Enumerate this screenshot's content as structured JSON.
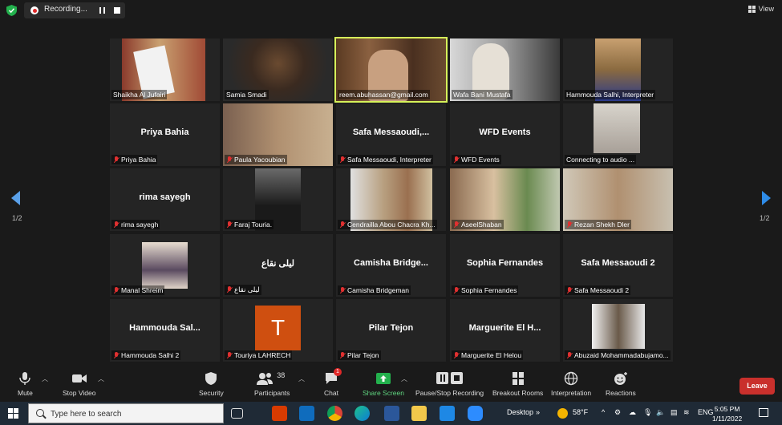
{
  "top_bar": {
    "recording_label": "Recording...",
    "view_label": "View"
  },
  "participants": [
    {
      "label": "Shaikha Al Jufairi",
      "center_name": "",
      "muted": false,
      "video": true
    },
    {
      "label": "Samia Smadi",
      "center_name": "",
      "muted": false,
      "video": true
    },
    {
      "label": "reem.abuhassan@gmail.com",
      "center_name": "",
      "muted": false,
      "video": true,
      "active_speaker": true
    },
    {
      "label": "Wafa Bani Mustafa",
      "center_name": "",
      "muted": false,
      "video": true
    },
    {
      "label": "Hammouda Salhi, Interpreter",
      "center_name": "",
      "muted": false,
      "video": true
    },
    {
      "label": "Priya Bahia",
      "center_name": "Priya Bahia",
      "muted": true,
      "video": false
    },
    {
      "label": "Paula Yacoubian",
      "center_name": "",
      "muted": true,
      "video": true
    },
    {
      "label": "Safa Messaoudi, Interpreter",
      "center_name": "Safa  Messaoudi,...",
      "muted": true,
      "video": false
    },
    {
      "label": "WFD Events",
      "center_name": "WFD Events",
      "muted": true,
      "video": false
    },
    {
      "label": "Connecting to audio ...",
      "center_name": "",
      "muted": false,
      "video": true
    },
    {
      "label": "rima sayegh",
      "center_name": "rima sayegh",
      "muted": true,
      "video": false
    },
    {
      "label": "Faraj Touria.",
      "center_name": "",
      "muted": true,
      "video": true
    },
    {
      "label": "Cendrailla Abou Chacra Kh...",
      "center_name": "",
      "muted": true,
      "video": true
    },
    {
      "label": "AseelShaban",
      "center_name": "",
      "muted": true,
      "video": true
    },
    {
      "label": "Rezan Shekh Dler",
      "center_name": "",
      "muted": true,
      "video": true
    },
    {
      "label": "Manal Shreim",
      "center_name": "",
      "muted": true,
      "video": true
    },
    {
      "label": "ليلى نقاع",
      "center_name": "ليلى نقاع",
      "muted": true,
      "video": false
    },
    {
      "label": "Camisha Bridgeman",
      "center_name": "Camisha  Bridge...",
      "muted": true,
      "video": false
    },
    {
      "label": "Sophia Fernandes",
      "center_name": "Sophia Fernandes",
      "muted": true,
      "video": false
    },
    {
      "label": "Safa Messaoudi 2",
      "center_name": "Safa Messaoudi 2",
      "muted": true,
      "video": false
    },
    {
      "label": "Hammouda Salhi 2",
      "center_name": "Hammouda  Sal...",
      "muted": true,
      "video": false
    },
    {
      "label": "Touriya LAHRECH",
      "center_name": "",
      "muted": true,
      "video": false,
      "avatar_letter": "T"
    },
    {
      "label": "Pilar Tejon",
      "center_name": "Pilar Tejon",
      "muted": true,
      "video": false
    },
    {
      "label": "Marguerite El Helou",
      "center_name": "Marguerite  El H...",
      "muted": true,
      "video": false
    },
    {
      "label": "Abuzaid Mohammadabujamo...",
      "center_name": "",
      "muted": true,
      "video": true
    }
  ],
  "pagination": {
    "left": "1/2",
    "right": "1/2"
  },
  "toolbar": {
    "mute": "Mute",
    "stop_video": "Stop Video",
    "security": "Security",
    "participants": "Participants",
    "participants_count": "38",
    "chat": "Chat",
    "chat_badge": "1",
    "share_screen": "Share Screen",
    "recording": "Pause/Stop Recording",
    "breakout": "Breakout Rooms",
    "interpretation": "Interpretation",
    "reactions": "Reactions",
    "leave": "Leave"
  },
  "taskbar": {
    "search_placeholder": "Type here to search",
    "desktop": "Desktop",
    "weather": "58°F",
    "lang": "ENG",
    "time": "5:05 PM",
    "date": "1/11/2022"
  },
  "colors": {
    "active_border": "#d6f25a",
    "leave": "#c9302c",
    "share_green": "#23b14d",
    "avatar": "#cf4f10"
  }
}
